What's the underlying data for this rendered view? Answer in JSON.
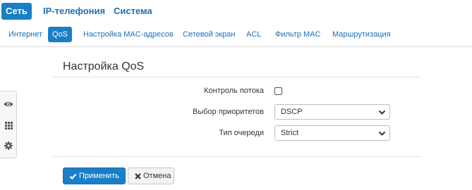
{
  "top_nav": {
    "items": [
      {
        "label": "Сеть",
        "active": true
      },
      {
        "label": "IP-телефония",
        "active": false
      },
      {
        "label": "Система",
        "active": false
      }
    ]
  },
  "sub_nav": {
    "items": [
      {
        "label": "Интернет",
        "active": false
      },
      {
        "label": "QoS",
        "active": true
      },
      {
        "label": "Настройка MAC-адресов",
        "active": false
      },
      {
        "label": "Сетевой экран",
        "active": false
      },
      {
        "label": "ACL",
        "active": false
      },
      {
        "label": "Фильтр MAC",
        "active": false
      },
      {
        "label": "Маршрутизация",
        "active": false
      }
    ]
  },
  "side_tools": {
    "icons": [
      "eye-icon",
      "grid-icon",
      "gear-icon"
    ]
  },
  "form": {
    "title": "Настройка QoS",
    "flow_control": {
      "label": "Контроль потока",
      "checked": false
    },
    "priority_selection": {
      "label": "Выбор приоритетов",
      "value": "DSCP"
    },
    "queue_type": {
      "label": "Тип очереди",
      "value": "Strict"
    }
  },
  "actions": {
    "apply_label": "Применить",
    "cancel_label": "Отмена"
  },
  "colors": {
    "accent": "#1a7fc6",
    "link": "#1f6fb2"
  }
}
